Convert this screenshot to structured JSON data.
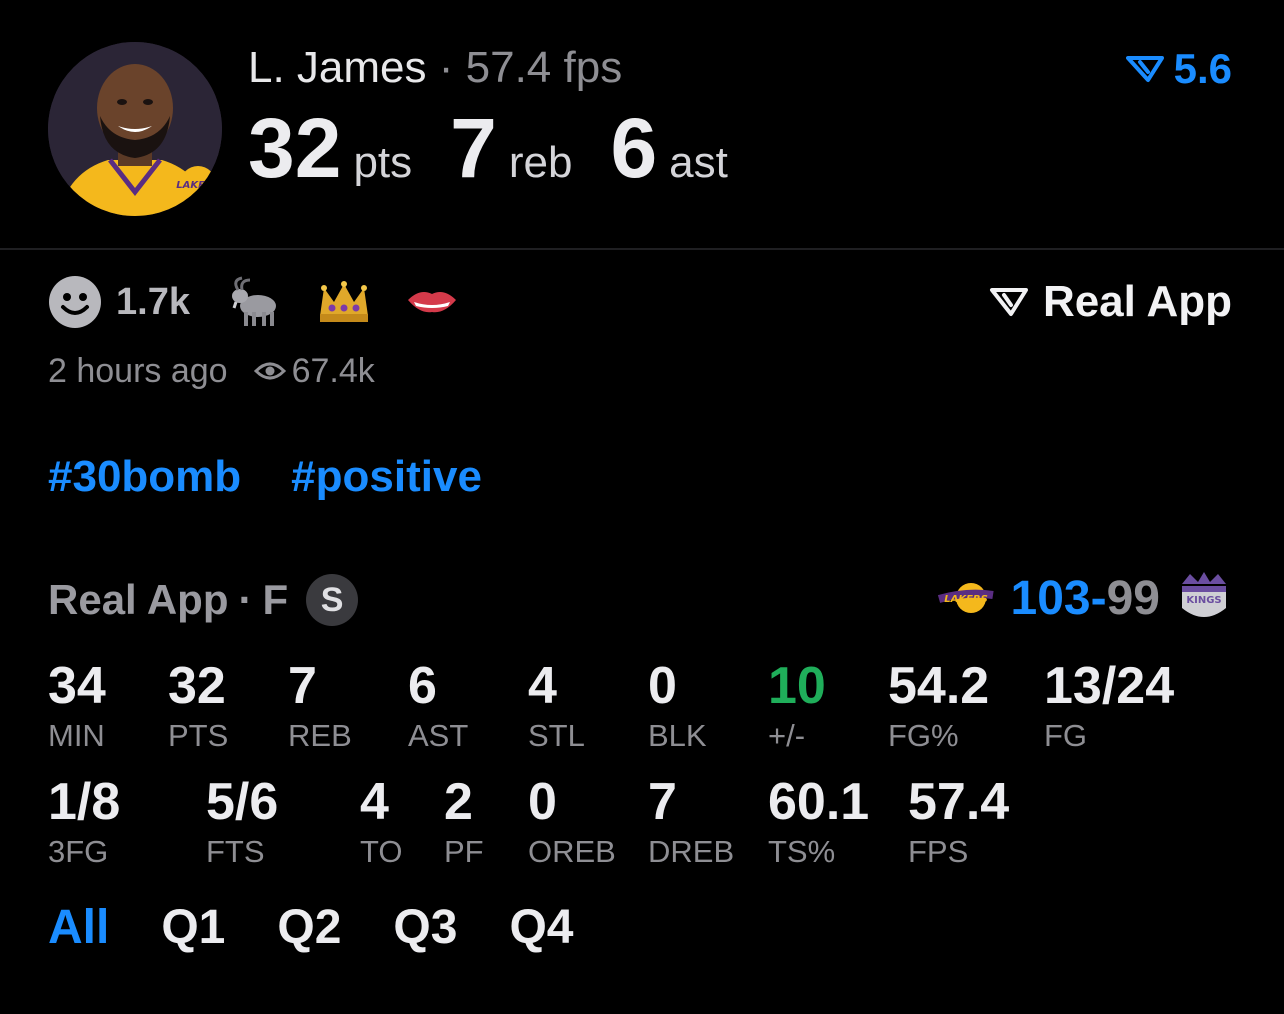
{
  "player": {
    "name": "L. James",
    "separator": "·",
    "fps": "57.4 fps",
    "pts": "32",
    "pts_label": "pts",
    "reb": "7",
    "reb_label": "reb",
    "ast": "6",
    "ast_label": "ast",
    "avatar_team_text": "LAKERS"
  },
  "rating": {
    "value": "5.6",
    "icon": "real-logo-icon"
  },
  "reactions": {
    "count": "1.7k",
    "icons": [
      "smiley-icon",
      "goat-icon",
      "crown-icon",
      "biting-lip-icon"
    ]
  },
  "source": {
    "label": "Real App",
    "icon": "real-logo-icon"
  },
  "meta": {
    "time": "2 hours ago",
    "views": "67.4k",
    "views_icon": "eye-icon"
  },
  "tags": [
    "#30bomb",
    "#positive"
  ],
  "game": {
    "source": "Real App",
    "separator": "·",
    "position": "F",
    "badge": "S",
    "home_score": "103",
    "dash": "-",
    "away_score": "99",
    "home_team_logo": "lakers-logo",
    "home_team_text": "LAKERS",
    "away_team_logo": "kings-logo",
    "away_team_text": "KINGS"
  },
  "stats_row1": [
    {
      "value": "34",
      "label": "MIN"
    },
    {
      "value": "32",
      "label": "PTS"
    },
    {
      "value": "7",
      "label": "REB"
    },
    {
      "value": "6",
      "label": "AST"
    },
    {
      "value": "4",
      "label": "STL"
    },
    {
      "value": "0",
      "label": "BLK"
    },
    {
      "value": "10",
      "label": "+/-"
    },
    {
      "value": "54.2",
      "label": "FG%"
    },
    {
      "value": "13/24",
      "label": "FG"
    }
  ],
  "stats_row2": [
    {
      "value": "1/8",
      "label": "3FG"
    },
    {
      "value": "5/6",
      "label": "FTS"
    },
    {
      "value": "4",
      "label": "TO"
    },
    {
      "value": "2",
      "label": "PF"
    },
    {
      "value": "0",
      "label": "OREB"
    },
    {
      "value": "7",
      "label": "DREB"
    },
    {
      "value": "60.1",
      "label": "TS%"
    },
    {
      "value": "57.4",
      "label": "FPS"
    }
  ],
  "quarter_tabs": [
    "All",
    "Q1",
    "Q2",
    "Q3",
    "Q4"
  ],
  "active_tab": "All",
  "colors": {
    "accent": "#1a8cff",
    "positive": "#1fae5a",
    "muted": "#8e8e93",
    "background": "#000000"
  }
}
